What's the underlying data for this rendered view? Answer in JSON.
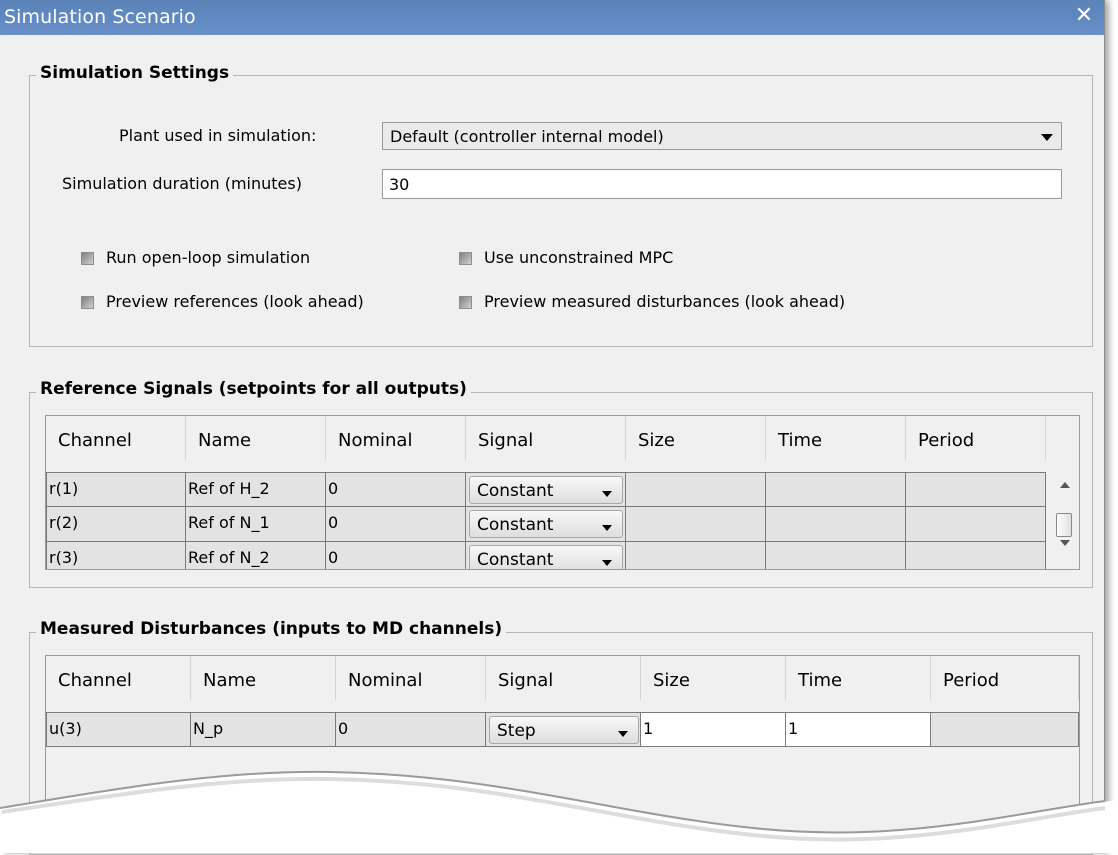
{
  "window": {
    "title": "Simulation Scenario",
    "close_glyph": "✕"
  },
  "simulation_settings": {
    "title": "Simulation Settings",
    "plant_label": "Plant used in simulation:",
    "plant_value": "Default (controller internal model)",
    "duration_label": "Simulation duration (minutes)",
    "duration_value": "30",
    "checkboxes": [
      {
        "label": "Run open-loop simulation",
        "checked": false
      },
      {
        "label": "Use unconstrained MPC",
        "checked": false
      },
      {
        "label": "Preview references (look ahead)",
        "checked": false
      },
      {
        "label": "Preview measured disturbances (look ahead)",
        "checked": false
      }
    ]
  },
  "reference_signals": {
    "title": "Reference Signals (setpoints for all outputs)",
    "columns": [
      "Channel",
      "Name",
      "Nominal",
      "Signal",
      "Size",
      "Time",
      "Period"
    ],
    "rows": [
      {
        "channel": "r(1)",
        "name": "Ref of H_2",
        "nominal": "0",
        "signal": "Constant",
        "size": "",
        "time": "",
        "period": ""
      },
      {
        "channel": "r(2)",
        "name": "Ref of N_1",
        "nominal": "0",
        "signal": "Constant",
        "size": "",
        "time": "",
        "period": ""
      },
      {
        "channel": "r(3)",
        "name": "Ref of N_2",
        "nominal": "0",
        "signal": "Constant",
        "size": "",
        "time": "",
        "period": ""
      }
    ]
  },
  "measured_disturbances": {
    "title": "Measured Disturbances (inputs to MD channels)",
    "columns": [
      "Channel",
      "Name",
      "Nominal",
      "Signal",
      "Size",
      "Time",
      "Period"
    ],
    "rows": [
      {
        "channel": "u(3)",
        "name": "N_p",
        "nominal": "0",
        "signal": "Step",
        "size": "1",
        "time": "1",
        "period": ""
      }
    ]
  },
  "colors": {
    "title_bar": "#5f88c0",
    "window_bg": "#f0f0f0",
    "cell_bg": "#e3e3e3"
  }
}
